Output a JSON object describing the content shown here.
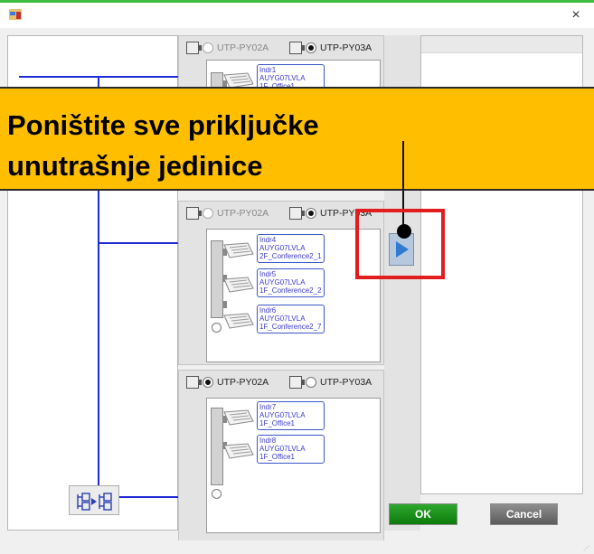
{
  "window": {
    "close_glyph": "×",
    "app_icon": "app-window-icon"
  },
  "groups": [
    {
      "radios": [
        {
          "label": "UTP-PY02A",
          "selected": false,
          "disabled": true
        },
        {
          "label": "UTP-PY03A",
          "selected": true,
          "disabled": false
        }
      ],
      "units": [
        {
          "lines": [
            "Indr1",
            "AUYG07LVLA",
            "1F_Office1"
          ]
        }
      ]
    },
    {
      "radios": [
        {
          "label": "UTP-PY02A",
          "selected": false,
          "disabled": true
        },
        {
          "label": "UTP-PY03A",
          "selected": true,
          "disabled": false
        }
      ],
      "units": [
        {
          "lines": [
            "Indr4",
            "AUYG07LVLA",
            "2F_Conference2_1"
          ]
        },
        {
          "lines": [
            "Indr5",
            "AUYG07LVLA",
            "1F_Conference2_2"
          ]
        },
        {
          "lines": [
            "Indr6",
            "AUYG07LVLA",
            "1F_Conference2_7"
          ]
        }
      ]
    },
    {
      "radios": [
        {
          "label": "UTP-PY02A",
          "selected": true,
          "disabled": false
        },
        {
          "label": "UTP-PY03A",
          "selected": false,
          "disabled": false
        }
      ],
      "units": [
        {
          "lines": [
            "Indr7",
            "AUYG07LVLA",
            "1F_Office1"
          ]
        },
        {
          "lines": [
            "Indr8",
            "AUYG07LVLA",
            "1F_Office1"
          ]
        }
      ]
    }
  ],
  "callout": {
    "text": "Poništite sve priključke\nunutrašnje jedinice"
  },
  "buttons": {
    "ok": "OK",
    "cancel": "Cancel"
  },
  "colors": {
    "callout": "#ffbf00",
    "highlight": "#e11d1d",
    "ok": "#1a8f1a",
    "tree_line": "#1f2bd6"
  }
}
